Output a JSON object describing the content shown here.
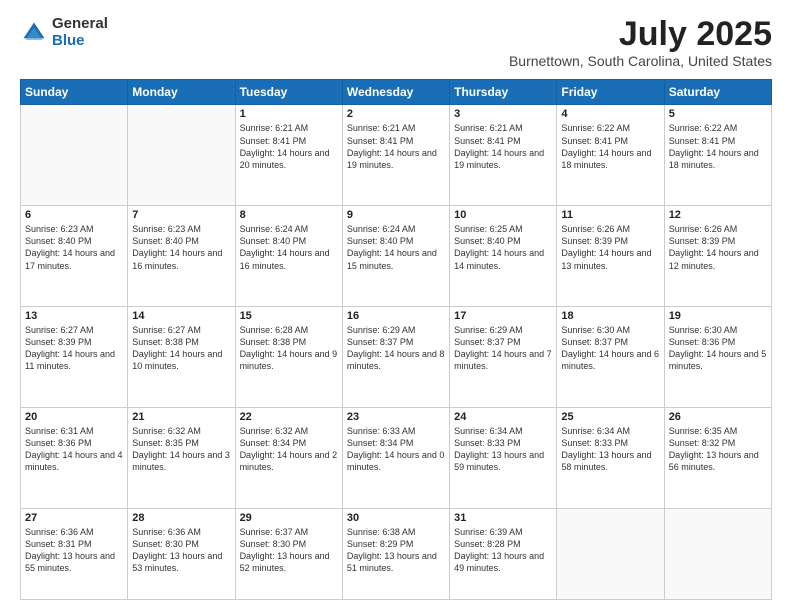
{
  "logo": {
    "general": "General",
    "blue": "Blue"
  },
  "header": {
    "title": "July 2025",
    "subtitle": "Burnettown, South Carolina, United States"
  },
  "weekdays": [
    "Sunday",
    "Monday",
    "Tuesday",
    "Wednesday",
    "Thursday",
    "Friday",
    "Saturday"
  ],
  "weeks": [
    [
      {
        "day": "",
        "info": ""
      },
      {
        "day": "",
        "info": ""
      },
      {
        "day": "1",
        "info": "Sunrise: 6:21 AM\nSunset: 8:41 PM\nDaylight: 14 hours and 20 minutes."
      },
      {
        "day": "2",
        "info": "Sunrise: 6:21 AM\nSunset: 8:41 PM\nDaylight: 14 hours and 19 minutes."
      },
      {
        "day": "3",
        "info": "Sunrise: 6:21 AM\nSunset: 8:41 PM\nDaylight: 14 hours and 19 minutes."
      },
      {
        "day": "4",
        "info": "Sunrise: 6:22 AM\nSunset: 8:41 PM\nDaylight: 14 hours and 18 minutes."
      },
      {
        "day": "5",
        "info": "Sunrise: 6:22 AM\nSunset: 8:41 PM\nDaylight: 14 hours and 18 minutes."
      }
    ],
    [
      {
        "day": "6",
        "info": "Sunrise: 6:23 AM\nSunset: 8:40 PM\nDaylight: 14 hours and 17 minutes."
      },
      {
        "day": "7",
        "info": "Sunrise: 6:23 AM\nSunset: 8:40 PM\nDaylight: 14 hours and 16 minutes."
      },
      {
        "day": "8",
        "info": "Sunrise: 6:24 AM\nSunset: 8:40 PM\nDaylight: 14 hours and 16 minutes."
      },
      {
        "day": "9",
        "info": "Sunrise: 6:24 AM\nSunset: 8:40 PM\nDaylight: 14 hours and 15 minutes."
      },
      {
        "day": "10",
        "info": "Sunrise: 6:25 AM\nSunset: 8:40 PM\nDaylight: 14 hours and 14 minutes."
      },
      {
        "day": "11",
        "info": "Sunrise: 6:26 AM\nSunset: 8:39 PM\nDaylight: 14 hours and 13 minutes."
      },
      {
        "day": "12",
        "info": "Sunrise: 6:26 AM\nSunset: 8:39 PM\nDaylight: 14 hours and 12 minutes."
      }
    ],
    [
      {
        "day": "13",
        "info": "Sunrise: 6:27 AM\nSunset: 8:39 PM\nDaylight: 14 hours and 11 minutes."
      },
      {
        "day": "14",
        "info": "Sunrise: 6:27 AM\nSunset: 8:38 PM\nDaylight: 14 hours and 10 minutes."
      },
      {
        "day": "15",
        "info": "Sunrise: 6:28 AM\nSunset: 8:38 PM\nDaylight: 14 hours and 9 minutes."
      },
      {
        "day": "16",
        "info": "Sunrise: 6:29 AM\nSunset: 8:37 PM\nDaylight: 14 hours and 8 minutes."
      },
      {
        "day": "17",
        "info": "Sunrise: 6:29 AM\nSunset: 8:37 PM\nDaylight: 14 hours and 7 minutes."
      },
      {
        "day": "18",
        "info": "Sunrise: 6:30 AM\nSunset: 8:37 PM\nDaylight: 14 hours and 6 minutes."
      },
      {
        "day": "19",
        "info": "Sunrise: 6:30 AM\nSunset: 8:36 PM\nDaylight: 14 hours and 5 minutes."
      }
    ],
    [
      {
        "day": "20",
        "info": "Sunrise: 6:31 AM\nSunset: 8:36 PM\nDaylight: 14 hours and 4 minutes."
      },
      {
        "day": "21",
        "info": "Sunrise: 6:32 AM\nSunset: 8:35 PM\nDaylight: 14 hours and 3 minutes."
      },
      {
        "day": "22",
        "info": "Sunrise: 6:32 AM\nSunset: 8:34 PM\nDaylight: 14 hours and 2 minutes."
      },
      {
        "day": "23",
        "info": "Sunrise: 6:33 AM\nSunset: 8:34 PM\nDaylight: 14 hours and 0 minutes."
      },
      {
        "day": "24",
        "info": "Sunrise: 6:34 AM\nSunset: 8:33 PM\nDaylight: 13 hours and 59 minutes."
      },
      {
        "day": "25",
        "info": "Sunrise: 6:34 AM\nSunset: 8:33 PM\nDaylight: 13 hours and 58 minutes."
      },
      {
        "day": "26",
        "info": "Sunrise: 6:35 AM\nSunset: 8:32 PM\nDaylight: 13 hours and 56 minutes."
      }
    ],
    [
      {
        "day": "27",
        "info": "Sunrise: 6:36 AM\nSunset: 8:31 PM\nDaylight: 13 hours and 55 minutes."
      },
      {
        "day": "28",
        "info": "Sunrise: 6:36 AM\nSunset: 8:30 PM\nDaylight: 13 hours and 53 minutes."
      },
      {
        "day": "29",
        "info": "Sunrise: 6:37 AM\nSunset: 8:30 PM\nDaylight: 13 hours and 52 minutes."
      },
      {
        "day": "30",
        "info": "Sunrise: 6:38 AM\nSunset: 8:29 PM\nDaylight: 13 hours and 51 minutes."
      },
      {
        "day": "31",
        "info": "Sunrise: 6:39 AM\nSunset: 8:28 PM\nDaylight: 13 hours and 49 minutes."
      },
      {
        "day": "",
        "info": ""
      },
      {
        "day": "",
        "info": ""
      }
    ]
  ]
}
